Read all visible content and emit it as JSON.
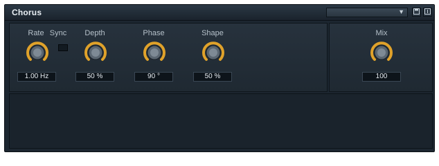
{
  "window": {
    "title": "Chorus",
    "preset_value": ""
  },
  "controls": [
    {
      "label": "Rate",
      "value": "1.00 Hz"
    },
    {
      "label": "Depth",
      "value": "50 %"
    },
    {
      "label": "Phase",
      "value": "90 °"
    },
    {
      "label": "Shape",
      "value": "50 %"
    },
    {
      "label": "Mix",
      "value": "100"
    }
  ],
  "sync": {
    "label": "Sync"
  },
  "toolbar": {
    "dropdown_icon": "▼",
    "save_icon": "save-icon",
    "menu_icon": "menu-icon"
  },
  "colors": {
    "knob_arc": "#e0a22a",
    "panel": "#1c2630",
    "text": "#b5c0c9"
  }
}
